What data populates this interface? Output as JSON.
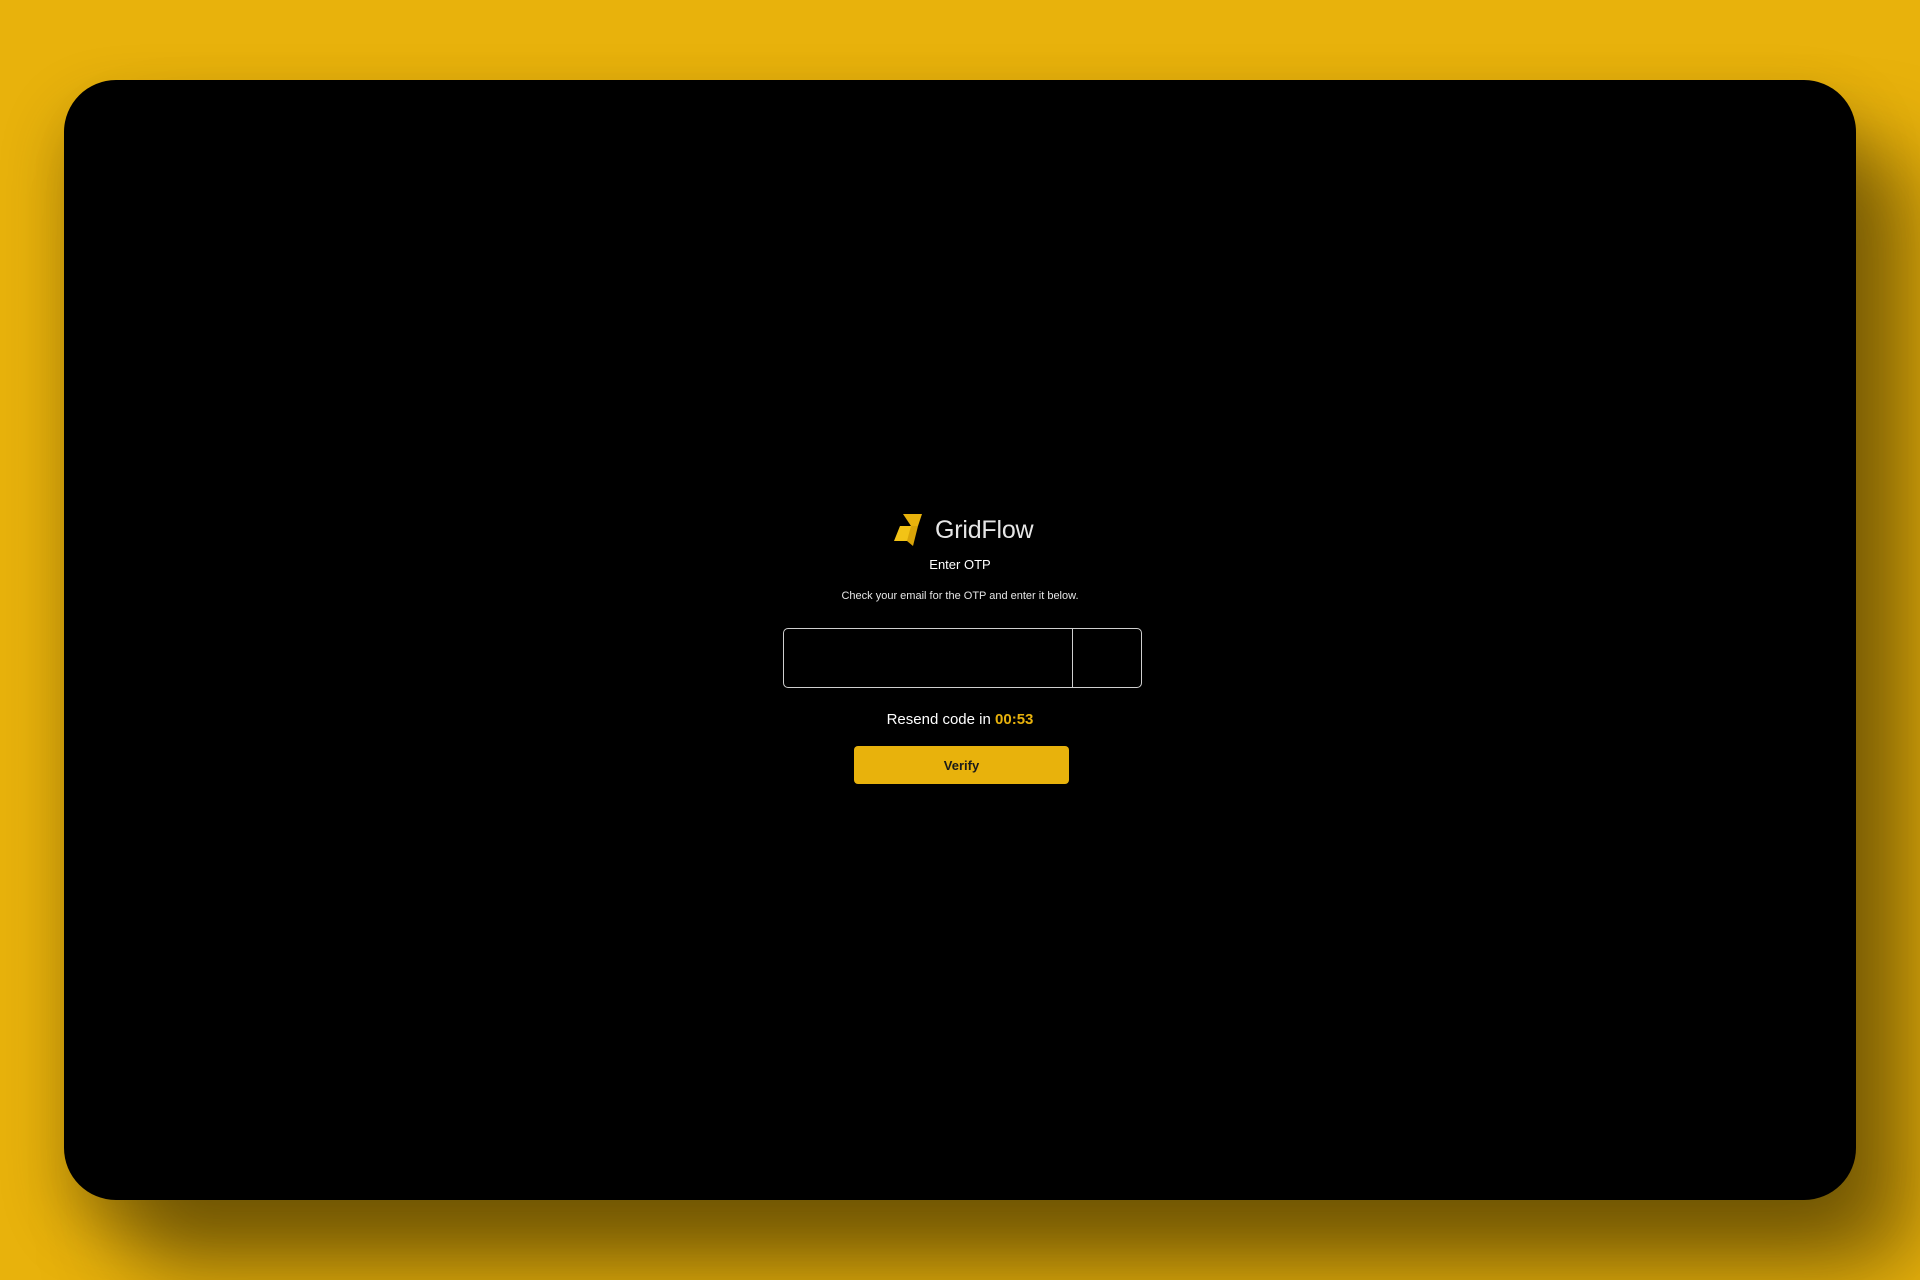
{
  "brand": {
    "name": "GridFlow",
    "logo_icon": "lightning-bolt-icon",
    "accent_color": "#E8B20C"
  },
  "otp": {
    "title": "Enter OTP",
    "subtitle": "Check your email for the OTP and enter it below.",
    "digits": [
      "",
      "",
      "",
      "",
      "",
      ""
    ]
  },
  "resend": {
    "label": "Resend code in",
    "timer": "00:53"
  },
  "actions": {
    "verify_label": "Verify"
  }
}
